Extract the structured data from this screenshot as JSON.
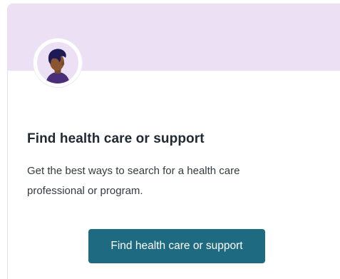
{
  "card": {
    "title": "Find health care or support",
    "description": "Get the best ways to search for a health care professional or program.",
    "button_label": "Find health care or support",
    "avatar_icon": "person-avatar-icon"
  },
  "colors": {
    "banner": "#ece0f5",
    "button": "#1e6a80",
    "title_text": "#1f2933",
    "body_text": "#333a40"
  }
}
